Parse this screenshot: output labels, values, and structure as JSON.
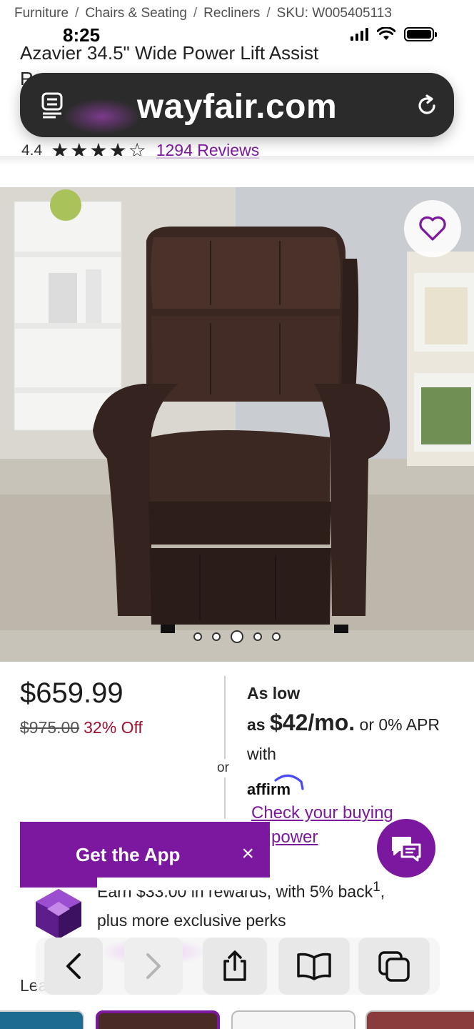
{
  "breadcrumb": {
    "items": [
      "Furniture",
      "Chairs & Seating",
      "Recliners"
    ],
    "sku": "SKU: W005405113",
    "separator": "/"
  },
  "status_bar": {
    "time": "8:25"
  },
  "browser": {
    "url": "wayfair.com"
  },
  "product": {
    "title": "Azavier 34.5\" Wide Power Lift Assist",
    "title_line2_fragment": "R",
    "rating_value": "4.4",
    "stars": 4.4,
    "reviews_link": "1294 Reviews",
    "image_count": 5,
    "active_image_index": 2
  },
  "pricing": {
    "sale_price": "$659.99",
    "original_price": "$975.00",
    "discount": "32% Off",
    "or_label": "or",
    "financing_as_low": "As low",
    "financing_as": "as",
    "financing_amount": "$42/mo.",
    "financing_rest": "or 0% APR with",
    "affirm_logo_text": "affirm",
    "check_link_line1": "Check your buying",
    "check_link_line2": "power"
  },
  "get_app_banner": {
    "label": "Get the App",
    "close_symbol": "×"
  },
  "rewards": {
    "line1": "Earn $33.00 in rewards, with 5% back",
    "superscript": "1",
    "line1_end": ",",
    "line2": "plus more exclusive perks"
  },
  "learn_more_fragment": "Lea",
  "colors": {
    "brand_purple": "#7b189f",
    "discount_red": "#a01030",
    "url_bar_bg": "#2b2b2b"
  },
  "icons": {
    "reader": "reader-mode-icon",
    "reload": "reload-icon",
    "favorite": "heart-icon",
    "chat": "chat-icon",
    "back": "chevron-left-icon",
    "forward": "chevron-right-icon",
    "share": "share-icon",
    "bookmarks": "book-icon",
    "tabs": "tabs-icon"
  }
}
